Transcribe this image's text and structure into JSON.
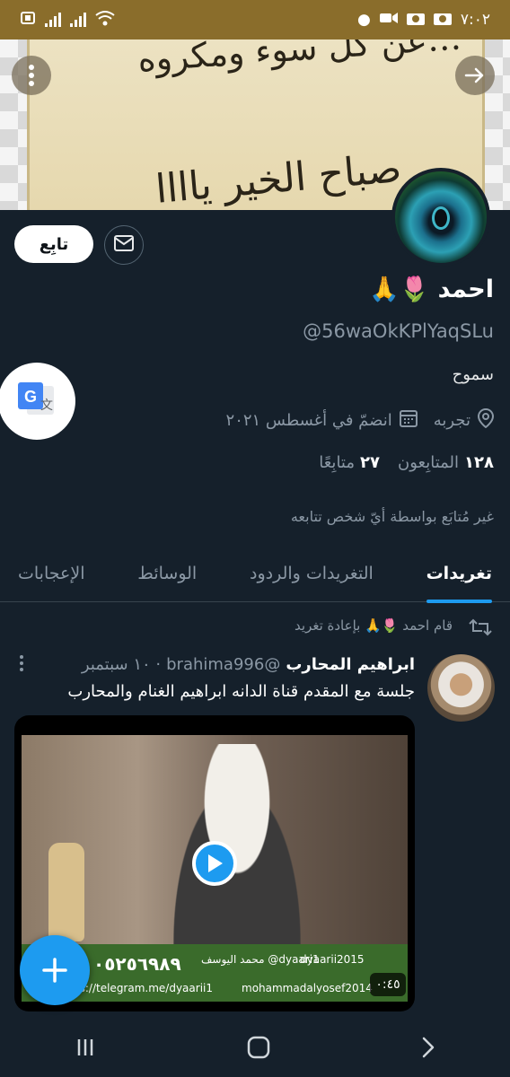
{
  "status_bar": {
    "time": "٧:٠٢"
  },
  "banner": {
    "line1": "…عن كل سوء ومكروه",
    "line2": "صباح الخير ياااا"
  },
  "profile": {
    "follow_label": "تابِع",
    "name": "احمد 🌷🙏",
    "handle": "@56waOkKPlYaqSLu",
    "bio": "سموح",
    "location": "تجربه",
    "joined": "انضمّ في أغسطس ٢٠٢١",
    "following_count": "٢٧",
    "following_label": "متابِعًا",
    "followers_count": "١٢٨",
    "followers_label": "المتابِعون",
    "not_followed": "غير مُتابَع بواسطة أيّ شخص تتابعه"
  },
  "tabs": [
    {
      "label": "تغريدات",
      "active": true
    },
    {
      "label": "التغريدات والردود"
    },
    {
      "label": "الوسائط"
    },
    {
      "label": "الإعجابات"
    }
  ],
  "tweet": {
    "retweet_label": "قام احمد 🌷🙏 بإعادة تغريد",
    "author": "ابراهيم المحارب",
    "handle": "@brahima996",
    "time": "· ١٠ سبتمبر",
    "text": "جلسة مع المقدم قناة الدانه ابراهيم الغنام والمحارب",
    "media": {
      "duration": "٠:٤٥",
      "phone": "٠٥٢٥٦٩٨٩",
      "twitter": "@dyaari1",
      "twitter_name": "محمد اليوسف",
      "instagram": "dyaarii2015",
      "telegram": "https://telegram.me/dyaarii1",
      "facebook": "mohammadalyosef2014"
    }
  },
  "colors": {
    "accent": "#1d9bf0",
    "background": "#15202b",
    "status_bar": "#8a6d2b"
  },
  "icons": {
    "banner_more": "more-vertical-icon",
    "banner_forward": "arrow-right-icon",
    "message": "envelope-icon",
    "location": "location-pin-icon",
    "calendar": "calendar-icon",
    "translate": "google-translate-icon",
    "retweet": "retweet-icon",
    "compose": "plus-icon",
    "nav_recents": "recents-icon",
    "nav_home": "home-icon",
    "nav_back": "back-chevron-icon"
  }
}
